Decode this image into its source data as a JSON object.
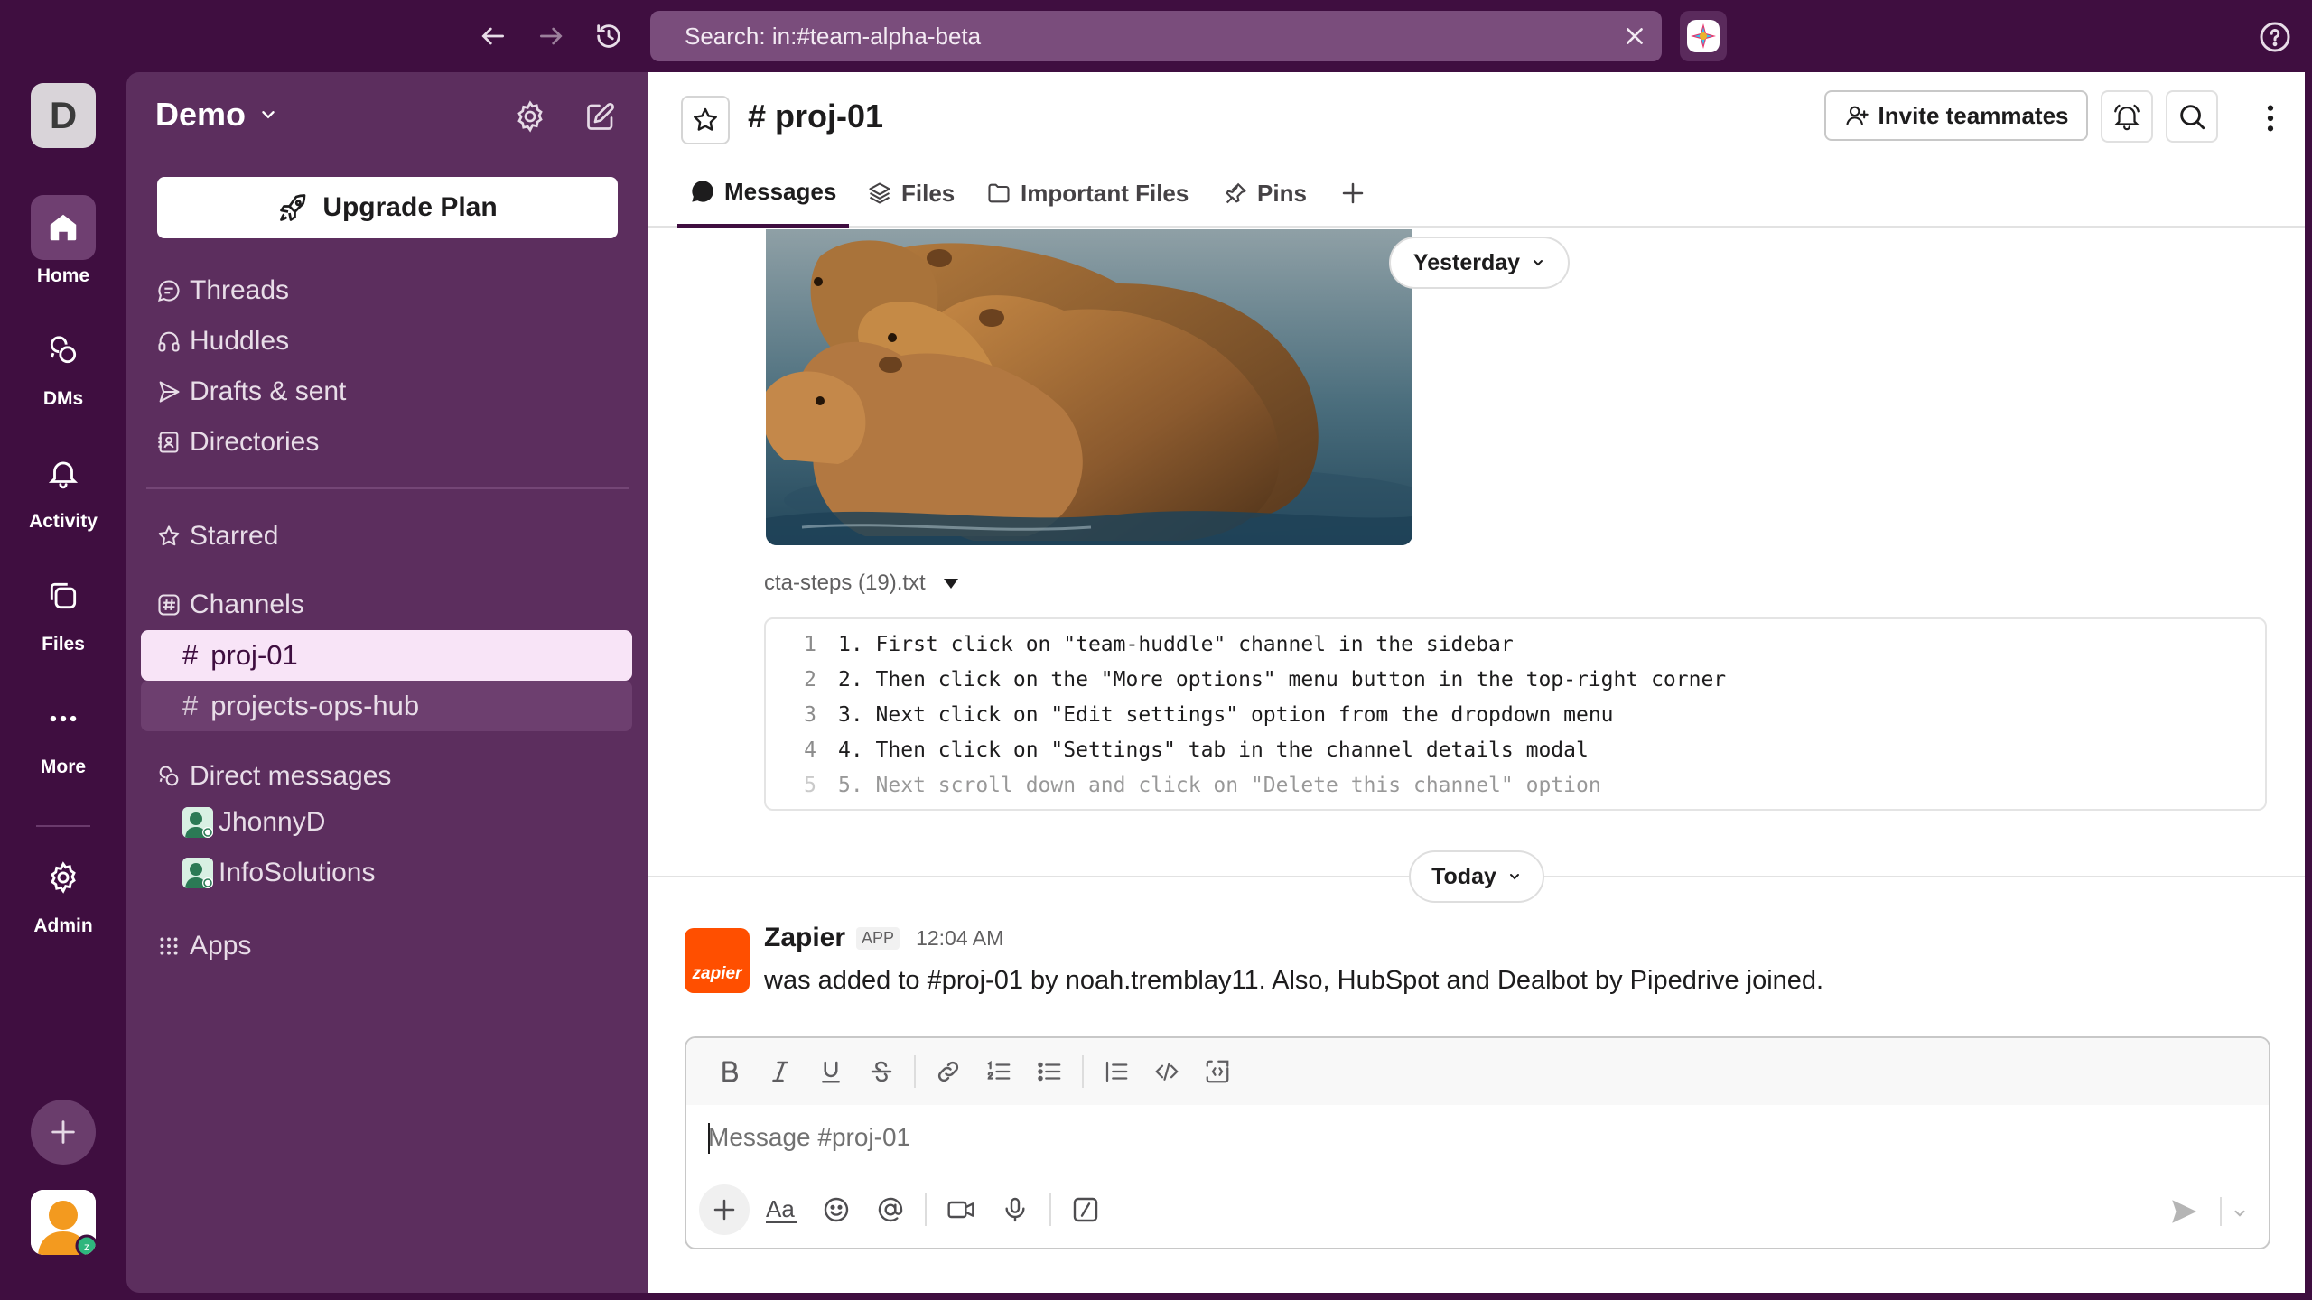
{
  "topbar": {
    "search_text": "Search: in:#team-alpha-beta",
    "back_icon": "arrow-left-icon",
    "forward_icon": "arrow-right-icon",
    "history_icon": "history-icon",
    "help_icon": "help-icon"
  },
  "rail": {
    "workspace_initial": "D",
    "items": [
      {
        "label": "Home",
        "icon": "home-icon"
      },
      {
        "label": "DMs",
        "icon": "dms-icon"
      },
      {
        "label": "Activity",
        "icon": "bell-icon"
      },
      {
        "label": "Files",
        "icon": "files-icon"
      },
      {
        "label": "More",
        "icon": "more-icon"
      },
      {
        "label": "Admin",
        "icon": "gear-icon"
      }
    ]
  },
  "sidebar": {
    "workspace_name": "Demo",
    "upgrade_label": "Upgrade Plan",
    "nav": [
      {
        "label": "Threads",
        "icon": "threads-icon"
      },
      {
        "label": "Huddles",
        "icon": "headphones-icon"
      },
      {
        "label": "Drafts & sent",
        "icon": "send-icon"
      },
      {
        "label": "Directories",
        "icon": "directory-icon"
      }
    ],
    "starred_label": "Starred",
    "channels_label": "Channels",
    "channels": [
      {
        "name": "proj-01",
        "state": "active"
      },
      {
        "name": "projects-ops-hub",
        "state": "unread"
      }
    ],
    "dms_label": "Direct messages",
    "dms": [
      {
        "name": "JhonnyD"
      },
      {
        "name": "InfoSolutions"
      }
    ],
    "apps_label": "Apps"
  },
  "channel": {
    "name": "proj-01",
    "invite_label": "Invite teammates",
    "tabs": [
      {
        "label": "Messages",
        "icon": "message-icon"
      },
      {
        "label": "Files",
        "icon": "layers-icon"
      },
      {
        "label": "Important Files",
        "icon": "folder-icon"
      },
      {
        "label": "Pins",
        "icon": "pin-icon"
      }
    ]
  },
  "messages": {
    "date_yesterday": "Yesterday",
    "date_today": "Today",
    "file_name": "cta-steps (19).txt",
    "code_lines": [
      {
        "n": "1",
        "text": "1. First click on \"team-huddle\" channel in the sidebar"
      },
      {
        "n": "2",
        "text": "2. Then click on the \"More options\" menu button in the top-right corner"
      },
      {
        "n": "3",
        "text": "3. Next click on \"Edit settings\" option from the dropdown menu"
      },
      {
        "n": "4",
        "text": "4. Then click on \"Settings\" tab in the channel details modal"
      },
      {
        "n": "5",
        "text": "5. Next scroll down and click on \"Delete this channel\" option"
      }
    ],
    "post": {
      "avatar_text": "zapier",
      "author": "Zapier",
      "badge": "APP",
      "time": "12:04 AM",
      "body": "was added to #proj-01 by noah.tremblay11. Also, HubSpot and Dealbot by Pipedrive joined."
    }
  },
  "composer": {
    "placeholder": "Message #proj-01"
  },
  "colors": {
    "aubergine": "#3f0e40",
    "sidebar": "#5c2e5e",
    "active_channel": "#f8e4f7",
    "zapier": "#ff4f00"
  }
}
